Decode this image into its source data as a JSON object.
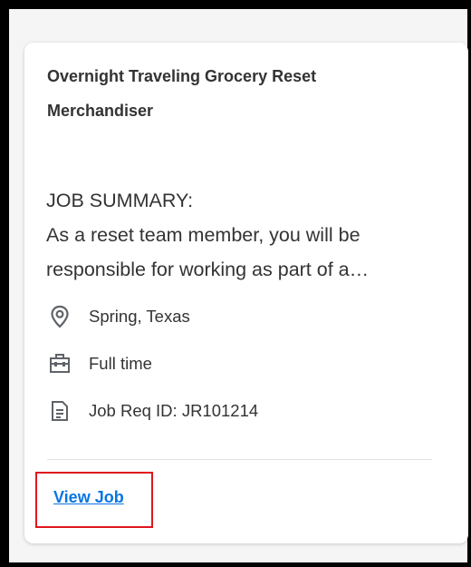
{
  "job": {
    "title": "Overnight Traveling Grocery Reset Merchandiser",
    "summary_heading": "JOB SUMMARY:",
    "summary_text": "As a reset team member, you will be responsible for working as part of a…",
    "location": "Spring, Texas",
    "time_type": "Full time",
    "req_id": "Job Req ID: JR101214",
    "view_label": "View Job"
  },
  "icons": {
    "location": "location-pin-icon",
    "time_type": "briefcase-icon",
    "req_id": "document-icon"
  },
  "colors": {
    "link": "#0875e1",
    "highlight": "#e0161e",
    "text": "#333333"
  }
}
